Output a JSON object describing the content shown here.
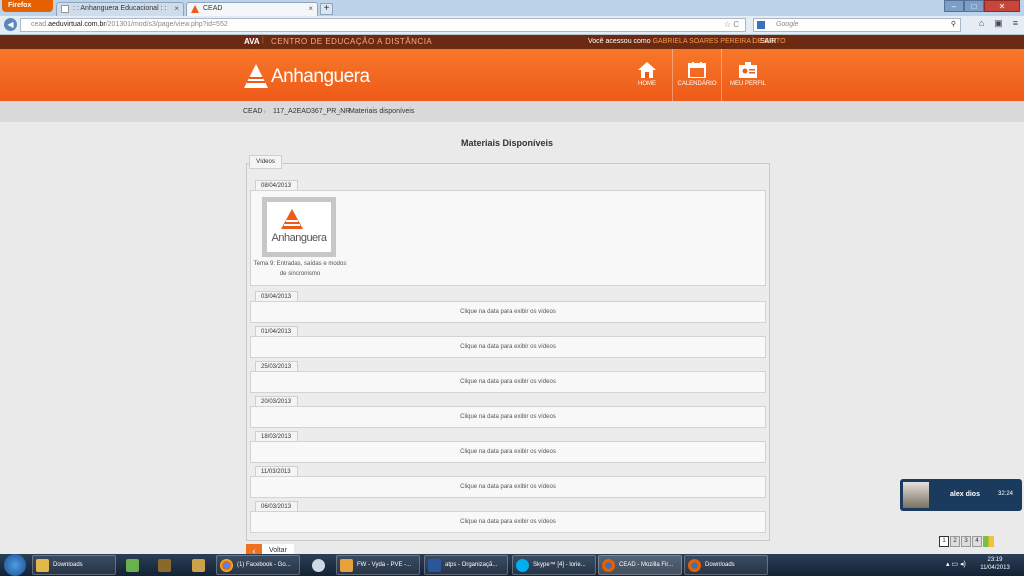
{
  "browser": {
    "firefox_label": "Firefox",
    "tabs": [
      {
        "title": ": : Anhanguera Educacional : :"
      },
      {
        "title": "CEAD"
      }
    ],
    "new_tab": "+",
    "tab_close": "×",
    "url_prefix": "cead.",
    "url_domain": "aeduvirtual.com.br",
    "url_path": "/201301/mod/s3/page/view.php?id=552",
    "search_placeholder": "Google",
    "back": "◀"
  },
  "site": {
    "ava": "AVA",
    "centro": "CENTRO DE EDUCAÇÃO A DISTÂNCIA",
    "accessed_label": "Você acessou como",
    "user_name": "GABRIELA SOARES PEREIRA DE BRITO",
    "logout": "SAIR",
    "brand": "Anhanguera",
    "nav": [
      {
        "label": "HOME"
      },
      {
        "label": "CALENDÁRIO"
      },
      {
        "label": "MEU PERFIL"
      }
    ]
  },
  "breadcrumb": [
    "CEAD",
    "117_A2EAD367_PR_NR",
    "Materiais disponíveis"
  ],
  "page": {
    "title": "Materiais Disponíveis",
    "section_tab": "Vídeos",
    "first_date": "08/04/2013",
    "video_brand": "Anhanguera",
    "video_caption": "Tema 9: Entradas, saídas e modos de sincronismo",
    "dates": [
      "03/04/2013",
      "01/04/2013",
      "25/03/2013",
      "20/03/2013",
      "18/03/2013",
      "11/03/2013",
      "06/03/2013"
    ],
    "collapsed_text": "Clique na data para exibir os vídeos",
    "back_button": "Voltar"
  },
  "chat": {
    "name": "alex dios",
    "time": "32:24"
  },
  "pager": [
    "1",
    "2",
    "3",
    "4"
  ],
  "taskbar": {
    "items": [
      {
        "label": "Downloads"
      },
      {
        "label": "(1) Facebook - Go..."
      },
      {
        "label": "FW - Vyda - PVE -..."
      },
      {
        "label": "atps - Organizaçã..."
      },
      {
        "label": "Skype™ [4] - lorie..."
      },
      {
        "label": "CEAD - Mozilla Fir..."
      },
      {
        "label": "Downloads"
      }
    ],
    "clock_time": "23:19",
    "clock_date": "11/04/2013"
  },
  "colors": {
    "brand_orange": "#ee5b18",
    "topbar_brown": "#6c2a12",
    "accent_name": "#f79a4a"
  }
}
